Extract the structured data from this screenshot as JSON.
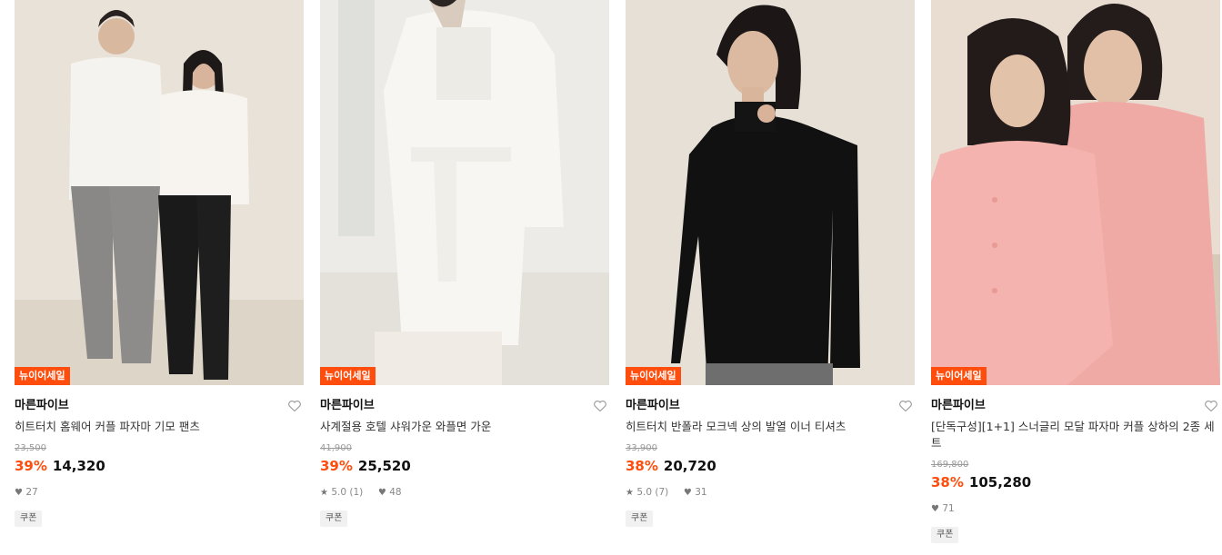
{
  "products": [
    {
      "badge": "뉴이어세일",
      "brand": "마른파이브",
      "title": "히트터치 홈웨어 커플 파자마 기모 팬츠",
      "original_price": "23,500",
      "discount": "39%",
      "price": "14,320",
      "rating": "",
      "reviews": "",
      "likes": "27",
      "coupon": "쿠폰",
      "heart_icon": "heart-outline-icon"
    },
    {
      "badge": "뉴이어세일",
      "brand": "마른파이브",
      "title": "사계절용 호텔 샤워가운 와플면 가운",
      "original_price": "41,900",
      "discount": "39%",
      "price": "25,520",
      "rating": "5.0",
      "reviews": "(1)",
      "likes": "48",
      "coupon": "쿠폰",
      "heart_icon": "heart-outline-icon"
    },
    {
      "badge": "뉴이어세일",
      "brand": "마른파이브",
      "title": "히트터치 반폴라 모크넥 상의 발열 이너 티셔츠",
      "original_price": "33,900",
      "discount": "38%",
      "price": "20,720",
      "rating": "5.0",
      "reviews": "(7)",
      "likes": "31",
      "coupon": "쿠폰",
      "heart_icon": "heart-outline-icon"
    },
    {
      "badge": "뉴이어세일",
      "brand": "마른파이브",
      "title": "[단독구성][1+1] 스너글리 모달 파자마 커플 상하의 2종 세트",
      "original_price": "169,800",
      "discount": "38%",
      "price": "105,280",
      "rating": "",
      "reviews": "",
      "likes": "71",
      "coupon": "쿠폰",
      "heart_icon": "heart-outline-icon"
    }
  ],
  "colors": {
    "accent": "#ff4d0d",
    "text": "#111111",
    "muted": "#9a9a9a"
  }
}
